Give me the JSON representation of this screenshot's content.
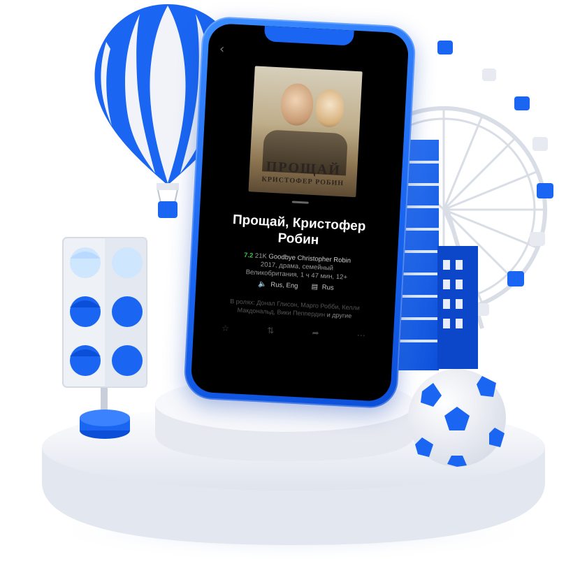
{
  "movie": {
    "poster_title": "ПРОЩАЙ",
    "poster_subtitle": "КРИСТОФЕР РОБИН",
    "title": "Прощай, Кристофер Робин",
    "rating": "7.2",
    "votes": "21K",
    "original_title": "Goodbye Christopher Robin",
    "details_line1": "2017, драма, семейный",
    "details_line2": "Великобритания, 1 ч 47 мин, 12+",
    "audio": "Rus, Eng",
    "subtitles": "Rus",
    "cast": "В ролях: Донал Глисон, Марго Робби, Келли Макдональд, Вики Пеппердин",
    "cast_more": "и другие"
  },
  "icons": {
    "back": "chevron-left-icon",
    "audio": "speaker-icon",
    "subtitles": "subtitles-icon",
    "bookmark": "bookmark-icon",
    "rate": "thumbs-icon",
    "share": "share-icon",
    "more": "more-icon"
  },
  "colors": {
    "brand_blue": "#1a66f2",
    "rating_green": "#3bbf4a"
  }
}
